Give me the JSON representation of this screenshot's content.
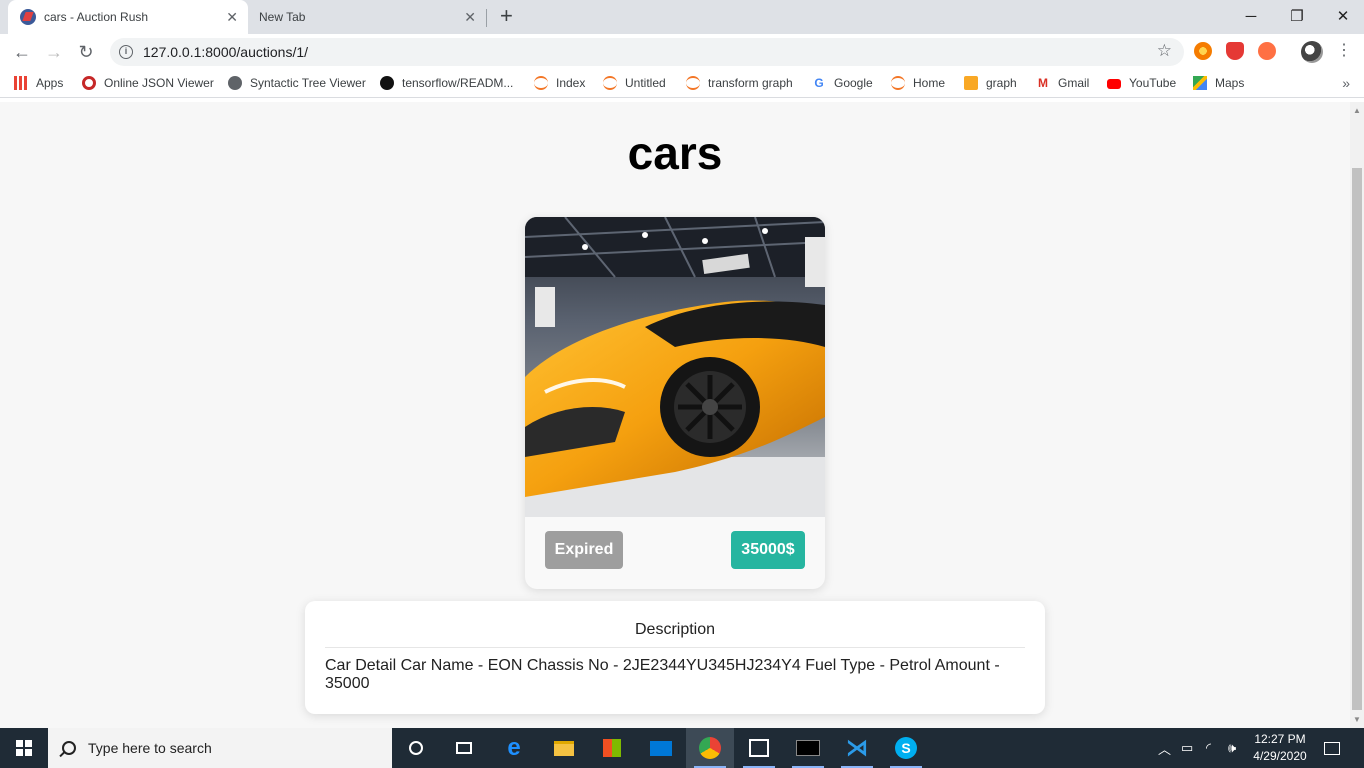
{
  "browser": {
    "tabs": [
      {
        "label": "cars - Auction Rush",
        "active": true
      },
      {
        "label": "New Tab",
        "active": false
      }
    ],
    "address": "127.0.0.1:8000/auctions/1/",
    "bookmarks": [
      {
        "label": "Apps",
        "icon": "apps-grid-icon"
      },
      {
        "label": "Online JSON Viewer",
        "icon": "json-viewer-icon"
      },
      {
        "label": "Syntactic Tree Viewer",
        "icon": "globe-icon"
      },
      {
        "label": "tensorflow/READM...",
        "icon": "github-icon"
      },
      {
        "label": "Index",
        "icon": "jupyter-icon"
      },
      {
        "label": "Untitled",
        "icon": "jupyter-icon"
      },
      {
        "label": "transform graph",
        "icon": "jupyter-icon"
      },
      {
        "label": "Google",
        "icon": "google-icon"
      },
      {
        "label": "Home",
        "icon": "jupyter-icon"
      },
      {
        "label": "graph",
        "icon": "book-icon"
      },
      {
        "label": "Gmail",
        "icon": "gmail-icon"
      },
      {
        "label": "YouTube",
        "icon": "youtube-icon"
      },
      {
        "label": "Maps",
        "icon": "maps-icon"
      }
    ]
  },
  "page": {
    "title": "cars",
    "card": {
      "status": "Expired",
      "price": "35000$"
    },
    "description": {
      "heading": "Description",
      "text": "Car Detail Car Name - EON Chassis No - 2JE2344YU345HJ234Y4 Fuel Type - Petrol Amount - 35000"
    }
  },
  "taskbar": {
    "search_placeholder": "Type here to search",
    "time": "12:27 PM",
    "date": "4/29/2020"
  },
  "colors": {
    "price_badge": "#26b5a0",
    "expired_badge": "#9e9e9e",
    "car_body": "#f5a00f"
  }
}
